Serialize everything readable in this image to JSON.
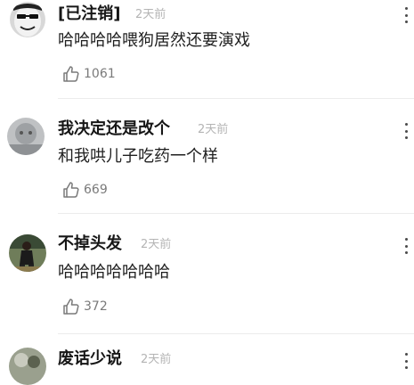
{
  "comments": [
    {
      "username": "[已注销]",
      "time": "2天前",
      "content": "哈哈哈哈喂狗居然还要演戏",
      "likes": "1061",
      "avatar_icon": "meme-face-avatar-icon"
    },
    {
      "username": "我决定还是改个",
      "time": "2天前",
      "content": "和我哄儿子吃药一个样",
      "likes": "669",
      "avatar_icon": "gray-photo-avatar-icon"
    },
    {
      "username": "不掉头发",
      "time": "2天前",
      "content": "哈哈哈哈哈哈哈",
      "likes": "372",
      "avatar_icon": "person-photo-avatar-icon"
    },
    {
      "username": "废话少说",
      "time": "2天前",
      "content": "",
      "likes": "",
      "avatar_icon": "photo-avatar-icon"
    }
  ],
  "icons": {
    "like": "thumbs-up-icon",
    "more": "more-dots-icon"
  },
  "colors": {
    "username": "#161616",
    "time": "#b4b4b4",
    "content": "#1f1f1f",
    "like_count": "#7a7a7a",
    "divider": "#ececec"
  }
}
